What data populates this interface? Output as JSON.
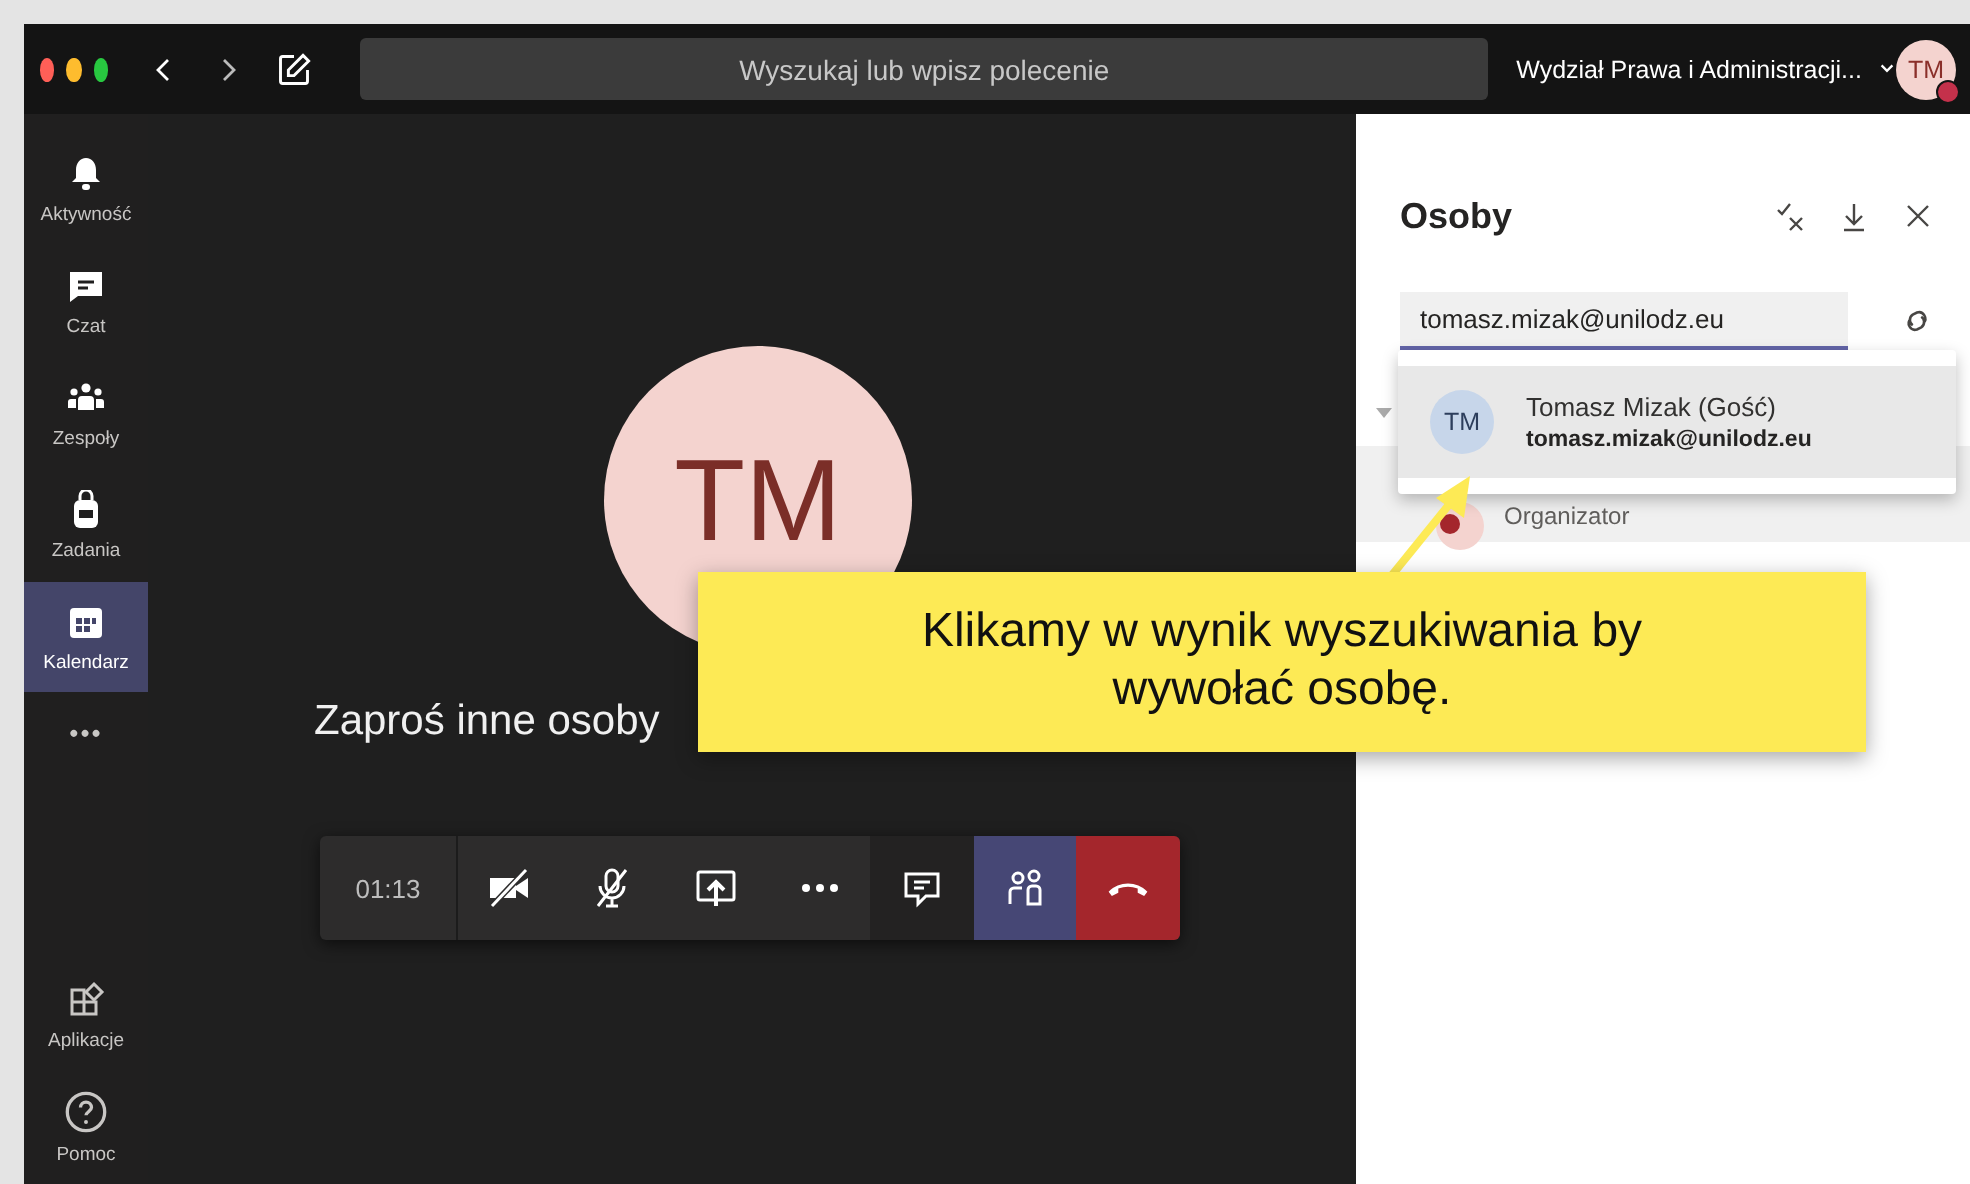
{
  "titlebar": {
    "search_placeholder": "Wyszukaj lub wpisz polecenie",
    "organization": "Wydział Prawa i Administracji...",
    "avatar": "TM"
  },
  "rail": {
    "items": [
      {
        "kind": "bell",
        "label": "Aktywność",
        "selected": false
      },
      {
        "kind": "chat",
        "label": "Czat",
        "selected": false
      },
      {
        "kind": "teams",
        "label": "Zespoły",
        "selected": false
      },
      {
        "kind": "bag",
        "label": "Zadania",
        "selected": false
      },
      {
        "kind": "calendar",
        "label": "Kalendarz",
        "selected": true
      }
    ],
    "more": "•••",
    "bottom_items": [
      {
        "kind": "apps",
        "label": "Aplikacje"
      },
      {
        "kind": "help",
        "label": "Pomoc"
      }
    ]
  },
  "stage": {
    "avatar": "TM",
    "invite": "Zaproś inne osoby"
  },
  "call_bar": {
    "timer": "01:13",
    "buttons": [
      {
        "kind": "camera-off",
        "selected": false
      },
      {
        "kind": "mic-off",
        "selected": false
      },
      {
        "kind": "share",
        "selected": false
      },
      {
        "kind": "more",
        "selected": false
      },
      {
        "kind": "chat",
        "selected": false
      },
      {
        "kind": "people",
        "selected": true
      },
      {
        "kind": "hangup",
        "selected": false
      }
    ]
  },
  "people_panel": {
    "title": "Osoby",
    "search_value": "tomasz.mizak@unilodz.eu",
    "suggestion": {
      "initials": "TM",
      "name": "Tomasz Mizak (Gość)",
      "email": "tomasz.mizak@unilodz.eu"
    },
    "row_behind": {
      "role": "Organizator"
    }
  },
  "callout": {
    "text": "Klikamy w wynik wyszukiwania by wywołać osobę."
  }
}
